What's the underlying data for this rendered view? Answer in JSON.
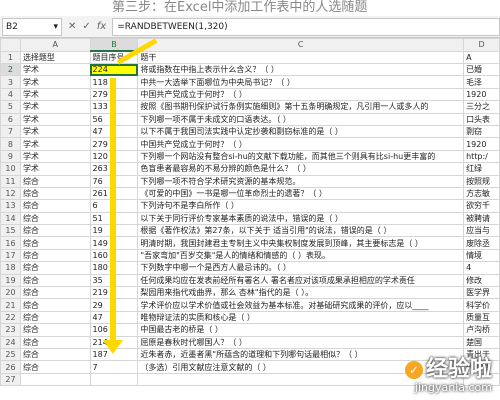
{
  "caption": "第三步：在Excel中添加工作表中的人选随题",
  "formula_bar": {
    "name_box": "B2",
    "fx_label": "fx",
    "formula": "=RANDBETWEEN(1,320)"
  },
  "columns": [
    "A",
    "B",
    "C",
    "D"
  ],
  "rows": [
    {
      "num": "1",
      "a": "选择题型",
      "b": "题目序号",
      "c": "题干",
      "d": "A"
    },
    {
      "num": "2",
      "a": "学术",
      "b": "224",
      "c": "将或指数在中指上表示什么含义？（ ）",
      "d": "已婚"
    },
    {
      "num": "3",
      "a": "学术",
      "b": "118",
      "c": "中共一大选举下面哪位为中央局书记？（ ）",
      "d": "毛泽"
    },
    {
      "num": "4",
      "a": "学术",
      "b": "279",
      "c": "中国共产党成立于何时？（ ）",
      "d": "1920"
    },
    {
      "num": "5",
      "a": "学术",
      "b": "133",
      "c": "按照《图书期刊保护试行条例实施细则》第十五条明确规定，凡引用一人或多人的",
      "d": "三分之"
    },
    {
      "num": "6",
      "a": "学术",
      "b": "56",
      "c": "下列哪一项不属于未成文的口语表达。（ ）",
      "d": "口头表"
    },
    {
      "num": "7",
      "a": "学术",
      "b": "47",
      "c": "以下不属于我国司法实践中认定抄袭和剽窃标准的是（ ）",
      "d": "剽窃"
    },
    {
      "num": "8",
      "a": "学术",
      "b": "279",
      "c": "中国共产党成立于何时？（ ）",
      "d": "1920"
    },
    {
      "num": "9",
      "a": "学术",
      "b": "120",
      "c": "下列哪一个网站没有整合si-hu的文献下载功能，而其他三个则具有比si-hu更丰富的",
      "d": "http:/"
    },
    {
      "num": "10",
      "a": "学术",
      "b": "263",
      "c": "色盲患者最容易的不易分辨的颜色是什么？（ ）",
      "d": "红绿"
    },
    {
      "num": "11",
      "a": "综合",
      "b": "76",
      "c": "下列哪一项不符合学术研究资源的基本规范。",
      "d": "按照规"
    },
    {
      "num": "12",
      "a": "综合",
      "b": "261",
      "c": "《可爱的中国》一书是哪一位革命烈士的遗著？（ ）",
      "d": "方志敏"
    },
    {
      "num": "13",
      "a": "综合",
      "b": "6",
      "c": "下列诗句不是李白所作（ ）",
      "d": "欲穷千"
    },
    {
      "num": "14",
      "a": "综合",
      "b": "51",
      "c": "以下关于同行评价专家基本素质的说法中，错误的是（ ）",
      "d": "被聘请"
    },
    {
      "num": "15",
      "a": "综合",
      "b": "19",
      "c": "根据《著作权法》第27条，以下关于 适当引用\"的说法，错误的是（ ）",
      "d": "应当与"
    },
    {
      "num": "16",
      "a": "综合",
      "b": "149",
      "c": "明清时期，我国封建君主专制主义中央集权制度发展到顶峰，其主要标志是（ ）",
      "d": "废除丞"
    },
    {
      "num": "17",
      "a": "综合",
      "b": "160",
      "c": "\"吾家弯加\"百岁交集\"是人的情绪和情感的（ ）表现。",
      "d": "情境"
    },
    {
      "num": "18",
      "a": "综合",
      "b": "180",
      "c": "下列数字中哪一个是西方人最忌讳的。（ ）",
      "d": "4"
    },
    {
      "num": "19",
      "a": "综合",
      "b": "35",
      "c": "任何成果均应在发表前经所有署名人    署名者应对该项成果承担相应的学术责任",
      "d": "修改"
    },
    {
      "num": "20",
      "a": "综合",
      "b": "219",
      "c": "梨园用来指代戏曲界，那么 杏林\"指代的是（ ）。",
      "d": "医学界"
    },
    {
      "num": "21",
      "a": "综合",
      "b": "29",
      "c": "学术评价应以学术价值或社会效益为基本标准。对基础研究成果的评价，应以____",
      "d": "科学价"
    },
    {
      "num": "22",
      "a": "综合",
      "b": "47",
      "c": "唯物辩证法的实质和核心是（ ）",
      "d": "质量互"
    },
    {
      "num": "23",
      "a": "综合",
      "b": "106",
      "c": "中国最古老的桥是（ ）",
      "d": "卢沟桥"
    },
    {
      "num": "24",
      "a": "综合",
      "b": "214",
      "c": "屈原是春秋时代哪国人？（ ）",
      "d": "楚国"
    },
    {
      "num": "25",
      "a": "综合",
      "b": "187",
      "c": "近朱者赤，近墨者黑\"所蕴含的道理和下列哪句话最相似？（ ）",
      "d": "青出于"
    },
    {
      "num": "26",
      "a": "综合",
      "b": "7",
      "c": "（多选）引用文献应注意文献的（ ）",
      "d": "代表性"
    },
    {
      "num": "27",
      "a": "",
      "b": "",
      "c": "",
      "d": ""
    }
  ],
  "watermark": {
    "text": "经验啦",
    "url": "jingyanla.com"
  },
  "colors": {
    "selected_fill": "#ffff00",
    "excel_green": "#217346",
    "arrow": "#ffd800"
  },
  "icons": {
    "namebox_dropdown": "chevron-down-icon",
    "cancel": "close-icon",
    "confirm": "check-icon"
  }
}
